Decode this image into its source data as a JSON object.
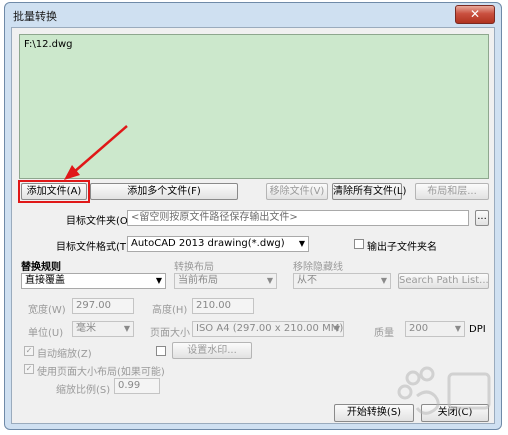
{
  "window": {
    "title": "批量转换",
    "close_glyph": "✕"
  },
  "files": {
    "items": [
      "F:\\12.dwg"
    ]
  },
  "file_buttons": {
    "add_file": "添加文件(A)",
    "add_multiple": "添加多个文件(F)",
    "remove_file": "移除文件(V)",
    "clear_all": "清除所有文件(L)",
    "layout_layers": "布局和层..."
  },
  "target_folder": {
    "label": "目标文件夹(O)",
    "placeholder": "<留空则按原文件路径保存输出文件>",
    "browse": "..."
  },
  "target_format": {
    "label": "目标文件格式(T)",
    "value": "AutoCAD 2013 drawing(*.dwg)",
    "output_subfolder_label": "输出子文件夹名"
  },
  "rules": {
    "replace_label": "替换规则",
    "replace_value": "直接覆盖",
    "layout_label": "转换布局",
    "layout_value": "当前布局",
    "font_label": "移除隐藏线",
    "font_value": "从不",
    "search_path_button": "Search Path List..."
  },
  "paper": {
    "width_label": "宽度(W)",
    "width_value": "297.00",
    "height_label": "高度(H)",
    "height_value": "210.00",
    "unit_label": "单位(U)",
    "unit_value": "毫米",
    "size_label": "页面大小",
    "size_value": "ISO A4 (297.00 x 210.00 MM)",
    "quality_label": "质量",
    "quality_value": "200",
    "dpi_label": "DPI"
  },
  "options": {
    "auto_scale_label": "自动缩放(Z)",
    "watermark_button": "设置水印...",
    "use_page_size_label": "使用页面大小布局(如果可能)",
    "scale_label": "缩放比例(S)",
    "scale_value": "0.99"
  },
  "actions": {
    "start": "开始转换(S)",
    "close": "关闭(C)"
  },
  "colors": {
    "list_bg": "#cce8cc",
    "highlight": "#e01818",
    "close_button": "#c9503f"
  }
}
